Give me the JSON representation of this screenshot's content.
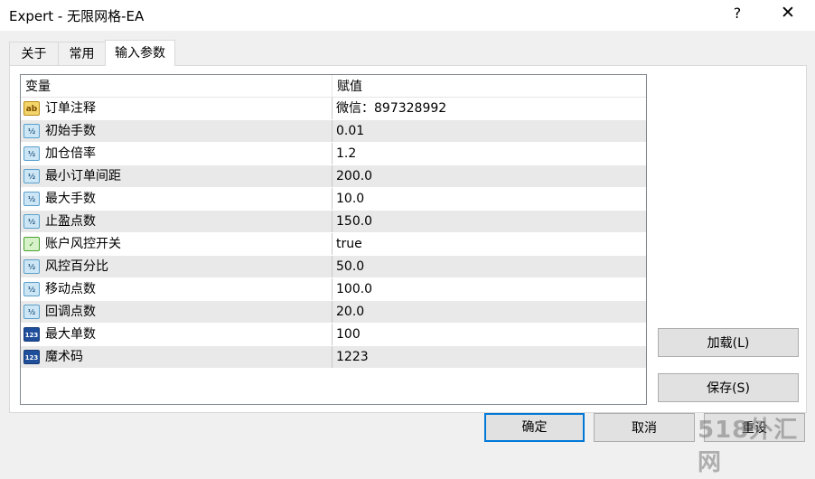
{
  "window": {
    "title": "Expert - 无限网格-EA",
    "help_glyph": "?",
    "close_glyph": "✕"
  },
  "tabs": [
    {
      "label": "关于"
    },
    {
      "label": "常用"
    },
    {
      "label": "输入参数",
      "active": true
    }
  ],
  "grid": {
    "headers": [
      "变量",
      "赋值"
    ],
    "rows": [
      {
        "icon": "ab-string-icon",
        "name": "订单注释",
        "value": "微信：897328992"
      },
      {
        "icon": "fraction-double-icon",
        "name": "初始手数",
        "value": "0.01"
      },
      {
        "icon": "fraction-double-icon",
        "name": "加仓倍率",
        "value": "1.2"
      },
      {
        "icon": "fraction-double-icon",
        "name": "最小订单间距",
        "value": "200.0"
      },
      {
        "icon": "fraction-double-icon",
        "name": "最大手数",
        "value": "10.0"
      },
      {
        "icon": "fraction-double-icon",
        "name": "止盈点数",
        "value": "150.0"
      },
      {
        "icon": "boolean-icon",
        "name": "账户风控开关",
        "value": "true"
      },
      {
        "icon": "fraction-double-icon",
        "name": "风控百分比",
        "value": "50.0"
      },
      {
        "icon": "fraction-double-icon",
        "name": "移动点数",
        "value": "100.0"
      },
      {
        "icon": "fraction-double-icon",
        "name": "回调点数",
        "value": "20.0"
      },
      {
        "icon": "integer-icon",
        "name": "最大单数",
        "value": "100"
      },
      {
        "icon": "integer-icon",
        "name": "魔术码",
        "value": "1223"
      }
    ]
  },
  "icon_glyphs": {
    "half": "½",
    "ab": "ab",
    "bool": "✓",
    "num": "123"
  },
  "buttons": {
    "load": "加载(L)",
    "save": "保存(S)",
    "ok": "确定",
    "cancel": "取消",
    "reset": "重设"
  },
  "watermark": "518外汇网",
  "colors": {
    "accent": "#0078d7",
    "alt_row": "#e9e9e9",
    "window_bg": "#f0f0f0"
  }
}
